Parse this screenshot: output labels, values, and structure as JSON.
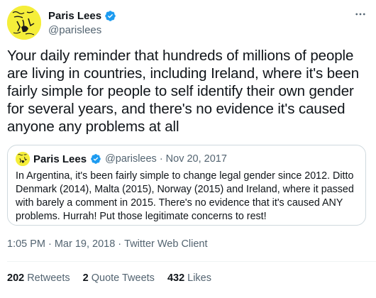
{
  "author": {
    "display_name": "Paris Lees",
    "handle": "@parislees",
    "verified": true
  },
  "tweet": {
    "text": "Your daily reminder that hundreds of millions of people are living in countries, including Ireland, where it's been fairly simple for people to self identify their own gender for several years, and there's no evidence it's caused anyone any problems at all"
  },
  "quote": {
    "display_name": "Paris Lees",
    "handle": "@parislees",
    "separator": "·",
    "date": "Nov 20, 2017",
    "text": "In Argentina, it's been fairly simple to change legal gender since 2012. Ditto Denmark (2014), Malta (2015), Norway (2015) and Ireland, where it passed with barely a comment in 2015. There's no evidence that it's caused ANY problems. Hurrah! Put those legitimate concerns to rest!"
  },
  "meta": {
    "time": "1:05 PM",
    "sep1": "·",
    "date": "Mar 19, 2018",
    "sep2": "·",
    "client": "Twitter Web Client"
  },
  "stats": {
    "retweets_count": "202",
    "retweets_label": "Retweets",
    "quotes_count": "2",
    "quotes_label": "Quote Tweets",
    "likes_count": "432",
    "likes_label": "Likes"
  },
  "colors": {
    "verified_blue": "#1d9bf0",
    "avatar_yellow": "#f5ee3a",
    "secondary_text": "#536471",
    "border": "#cfd9de"
  },
  "icons": {
    "verified": "verified-badge-icon",
    "more": "more-horizontal-icon"
  }
}
